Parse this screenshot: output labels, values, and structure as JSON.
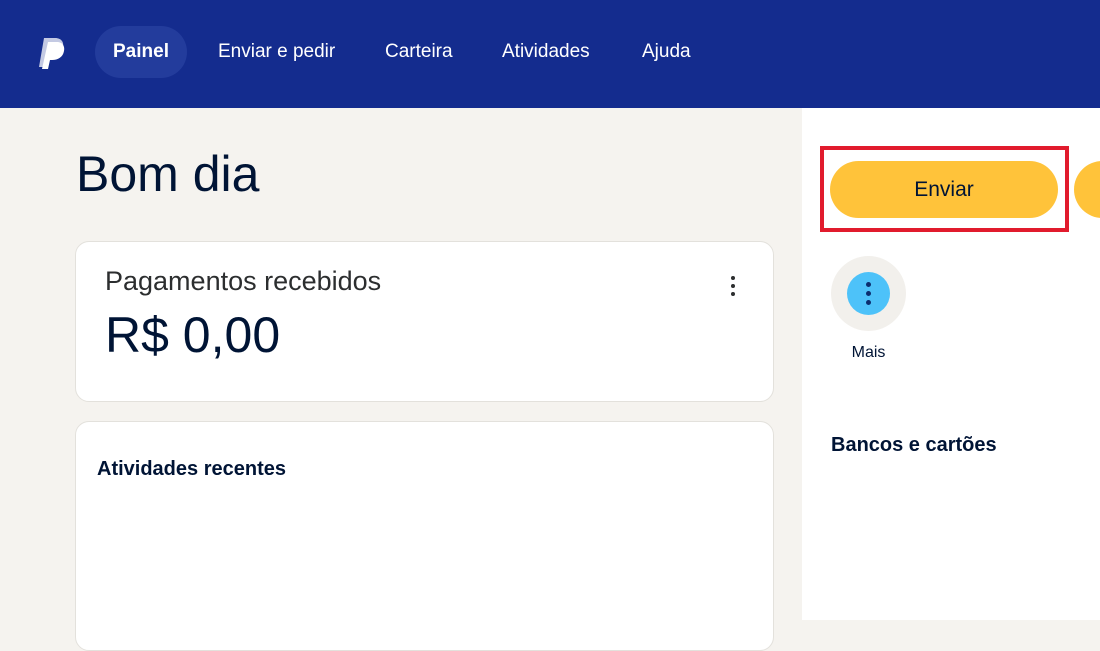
{
  "nav": {
    "items": [
      {
        "label": "Painel",
        "active": true
      },
      {
        "label": "Enviar e pedir"
      },
      {
        "label": "Carteira"
      },
      {
        "label": "Atividades"
      },
      {
        "label": "Ajuda"
      }
    ]
  },
  "main": {
    "greeting": "Bom dia",
    "payments_card": {
      "title": "Pagamentos recebidos",
      "amount": "R$ 0,00",
      "menu_icon": "more-vertical-icon"
    },
    "activity_card": {
      "title": "Atividades recentes"
    }
  },
  "sidebar": {
    "send_label": "Enviar",
    "more": {
      "label": "Mais",
      "icon": "more-vertical-icon"
    },
    "banks_title": "Bancos e cartões"
  },
  "colors": {
    "nav_bg": "#142c8e",
    "nav_active_bg": "#233c9c",
    "button_yellow": "#ffc33a",
    "highlight_red": "#e11b2d",
    "more_blue": "#4dc2f9",
    "page_bg": "#f5f3ef",
    "text_dark": "#001435"
  }
}
